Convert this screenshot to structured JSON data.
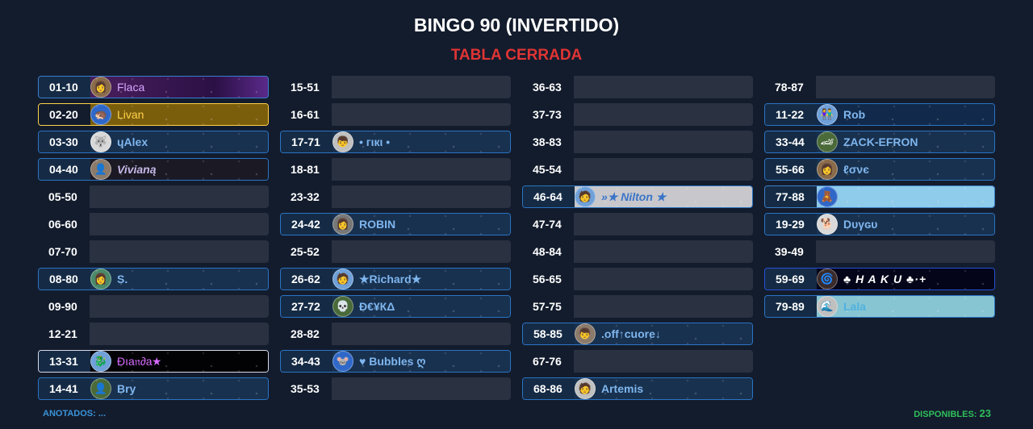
{
  "title": "BINGO 90 (INVERTIDO)",
  "status": "TABLA CERRADA",
  "footer": {
    "anotados_label": "ANOTADOS: ...",
    "disponibles_label": "DISPONIBLES:",
    "disponibles_count": "23"
  },
  "columns": [
    [
      {
        "number": "01-10",
        "name": "Flaca",
        "style": "purple",
        "icon": "👩"
      },
      {
        "number": "02-20",
        "name": "Livan",
        "style": "gold",
        "icon": "🦔"
      },
      {
        "number": "03-30",
        "name": "ɥAlex",
        "style": "taken",
        "icon": "🐺"
      },
      {
        "number": "04-40",
        "name": "Vivianą",
        "style": "dark",
        "icon": "👤"
      },
      {
        "number": "05-50",
        "name": "",
        "style": "empty",
        "icon": ""
      },
      {
        "number": "06-60",
        "name": "",
        "style": "empty",
        "icon": ""
      },
      {
        "number": "07-70",
        "name": "",
        "style": "empty",
        "icon": ""
      },
      {
        "number": "08-80",
        "name": "S.",
        "style": "taken",
        "icon": "👩"
      },
      {
        "number": "09-90",
        "name": "",
        "style": "empty",
        "icon": ""
      },
      {
        "number": "12-21",
        "name": "",
        "style": "empty",
        "icon": ""
      },
      {
        "number": "13-31",
        "name": "Ðıa𝔫∂a★",
        "style": "black",
        "icon": "🐉"
      },
      {
        "number": "14-41",
        "name": "Bry",
        "style": "taken",
        "icon": "👤"
      }
    ],
    [
      {
        "number": "15-51",
        "name": "",
        "style": "empty",
        "icon": ""
      },
      {
        "number": "16-61",
        "name": "",
        "style": "empty",
        "icon": ""
      },
      {
        "number": "17-71",
        "name": "• гιкι •",
        "style": "taken",
        "icon": "👦"
      },
      {
        "number": "18-81",
        "name": "",
        "style": "empty",
        "icon": ""
      },
      {
        "number": "23-32",
        "name": "",
        "style": "empty",
        "icon": ""
      },
      {
        "number": "24-42",
        "name": "ROBIN",
        "style": "taken",
        "icon": "👩"
      },
      {
        "number": "25-52",
        "name": "",
        "style": "empty",
        "icon": ""
      },
      {
        "number": "26-62",
        "name": "★Richard★",
        "style": "taken",
        "icon": "🧑"
      },
      {
        "number": "27-72",
        "name": "Ð€¥КΔ",
        "style": "taken",
        "icon": "💀"
      },
      {
        "number": "28-82",
        "name": "",
        "style": "empty",
        "icon": ""
      },
      {
        "number": "34-43",
        "name": "♥ Bubbles ღ",
        "style": "taken",
        "icon": "🐭"
      },
      {
        "number": "35-53",
        "name": "",
        "style": "empty",
        "icon": ""
      }
    ],
    [
      {
        "number": "36-63",
        "name": "",
        "style": "empty",
        "icon": ""
      },
      {
        "number": "37-73",
        "name": "",
        "style": "empty",
        "icon": ""
      },
      {
        "number": "38-83",
        "name": "",
        "style": "empty",
        "icon": ""
      },
      {
        "number": "45-54",
        "name": "",
        "style": "empty",
        "icon": ""
      },
      {
        "number": "46-64",
        "name": "»★ Nilton ★",
        "style": "lightgrey",
        "icon": "🧑"
      },
      {
        "number": "47-74",
        "name": "",
        "style": "empty",
        "icon": ""
      },
      {
        "number": "48-84",
        "name": "",
        "style": "empty",
        "icon": ""
      },
      {
        "number": "56-65",
        "name": "",
        "style": "empty",
        "icon": ""
      },
      {
        "number": "57-75",
        "name": "",
        "style": "empty",
        "icon": ""
      },
      {
        "number": "58-85",
        "name": ".off↑cuore↓",
        "style": "taken",
        "icon": "👦"
      },
      {
        "number": "67-76",
        "name": "",
        "style": "empty",
        "icon": ""
      },
      {
        "number": "68-86",
        "name": "Artemis",
        "style": "taken",
        "icon": "🧑"
      }
    ],
    [
      {
        "number": "78-87",
        "name": "",
        "style": "empty",
        "icon": ""
      },
      {
        "number": "11-22",
        "name": "Rob",
        "style": "navyplain",
        "icon": "👫"
      },
      {
        "number": "33-44",
        "name": "ZACK-EFRON",
        "style": "taken",
        "icon": "🏎"
      },
      {
        "number": "55-66",
        "name": "ℓσνє",
        "style": "taken",
        "icon": "👩"
      },
      {
        "number": "77-88",
        "name": "",
        "style": "skyblue",
        "icon": "🧸"
      },
      {
        "number": "19-29",
        "name": "Dυγɢυ",
        "style": "taken",
        "icon": "🐕"
      },
      {
        "number": "39-49",
        "name": "",
        "style": "empty",
        "icon": ""
      },
      {
        "number": "59-69",
        "name": "♣ H A K U ♣·+",
        "style": "navy",
        "icon": "🌀"
      },
      {
        "number": "79-89",
        "name": "Lala",
        "style": "teal",
        "icon": "🌊"
      }
    ]
  ]
}
